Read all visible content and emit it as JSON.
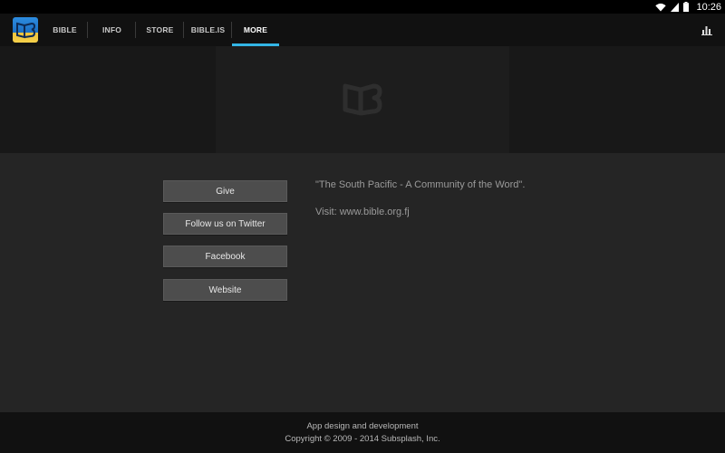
{
  "status_bar": {
    "time": "10:26",
    "icons": [
      "wifi-icon",
      "signal-icon",
      "battery-icon"
    ]
  },
  "action_bar": {
    "logo_icon": "bible-app-logo",
    "tabs": [
      {
        "label": "BIBLE",
        "active": false
      },
      {
        "label": "INFO",
        "active": false
      },
      {
        "label": "STORE",
        "active": false
      },
      {
        "label": "BIBLE.IS",
        "active": false
      },
      {
        "label": "MORE",
        "active": true
      }
    ],
    "menu_icon": "bars-icon",
    "accent_color": "#33b5e5"
  },
  "banner": {
    "logo_icon": "open-book-logo"
  },
  "buttons": {
    "give": "Give",
    "twitter": "Follow us on Twitter",
    "facebook": "Facebook",
    "website": "Website"
  },
  "info": {
    "quote": "\"The South Pacific - A Community of the Word\".",
    "visit": "Visit: www.bible.org.fj"
  },
  "footer": {
    "line1": "App design and development",
    "line2": "Copyright © 2009 - 2014 Subsplash, Inc."
  }
}
